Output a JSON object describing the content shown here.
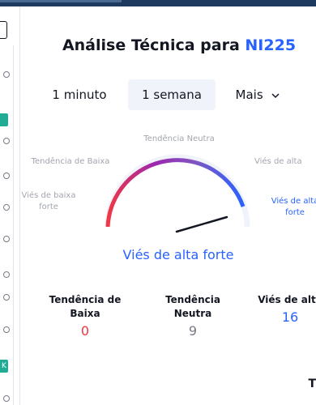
{
  "header": {
    "title_prefix": "Análise Técnica para ",
    "symbol": "NI225"
  },
  "tabs": [
    {
      "label": "1 minuto",
      "active": false
    },
    {
      "label": "1 semana",
      "active": true
    },
    {
      "label": "Mais",
      "active": false,
      "has_dropdown": true
    }
  ],
  "gauge": {
    "top_label": "Tendência Neutra",
    "left_upper_label": "Tendência de Baixa",
    "left_lower_label": "Viés de baixa forte",
    "right_upper_label": "Viés de alta",
    "right_lower_label": "Viés de alta forte",
    "verdict": "Viés de alta forte",
    "needle_level": 0.92,
    "colors": {
      "sell": "#f23645",
      "neutral": "#9598a1",
      "buy": "#2962ff"
    }
  },
  "counters": [
    {
      "label": "Tendência de Baixa",
      "value": "0",
      "color": "#f23645"
    },
    {
      "label": "Tendência Neutra",
      "value": "9",
      "color": "#787b86"
    },
    {
      "label": "Viés de alta",
      "value": "16",
      "color": "#2962ff"
    }
  ],
  "sidebar_badges": [
    {
      "text": "",
      "color": "#22ab94"
    },
    {
      "text": "K",
      "color": "#22ab94"
    }
  ],
  "logo": "T"
}
